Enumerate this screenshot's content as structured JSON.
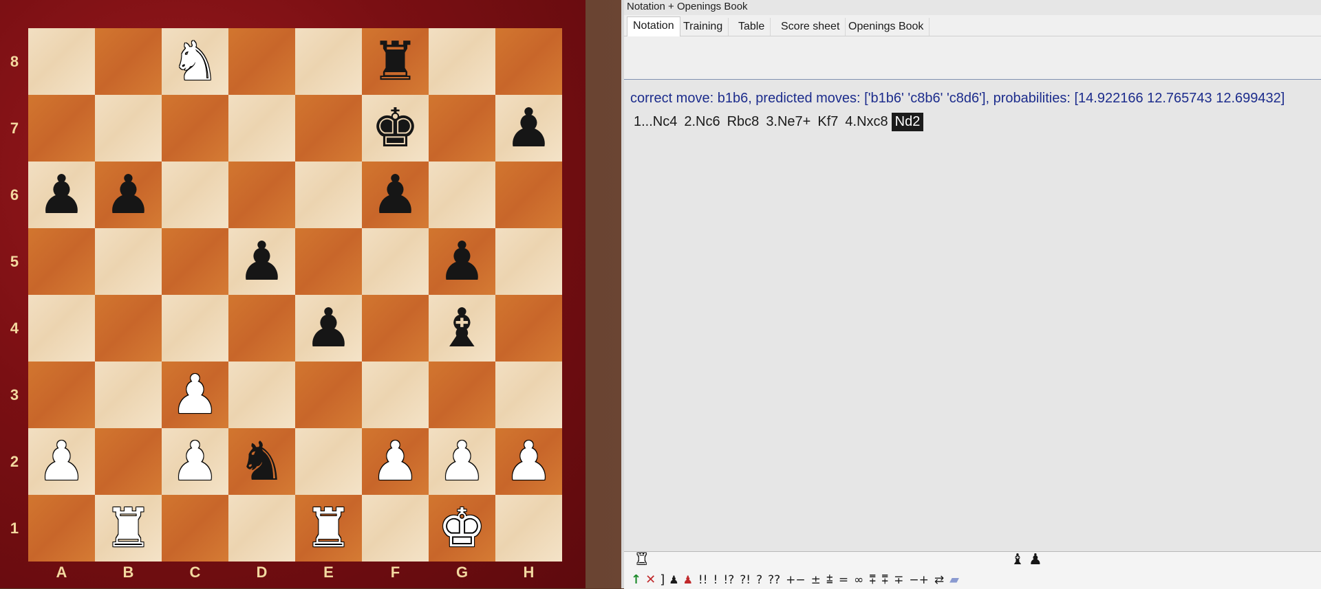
{
  "window": {
    "title": "Notation + Openings Book"
  },
  "tabs": [
    "Notation",
    "Training",
    "Table",
    "Score sheet",
    "Openings Book"
  ],
  "active_tab": "Notation",
  "prediction_text": "correct move: b1b6, predicted moves: ['b1b6' 'c8b6' 'c8d6'], probabilities: [14.922166 12.765743 12.699432]",
  "moves": [
    "1...Nc4",
    "2.Nc6",
    "Rbc8",
    "3.Ne7+",
    "Kf7",
    "4.Nxc8",
    "Nd2"
  ],
  "current_move": "Nd2",
  "board": {
    "files": [
      "A",
      "B",
      "C",
      "D",
      "E",
      "F",
      "G",
      "H"
    ],
    "ranks": [
      "8",
      "7",
      "6",
      "5",
      "4",
      "3",
      "2",
      "1"
    ],
    "pieces": {
      "c8": "♞w",
      "f8": "♜b",
      "f7": "♚b",
      "h7": "♟b",
      "a6": "♟b",
      "b6": "♟b",
      "f6": "♟b",
      "d5": "♟b",
      "g5": "♟b",
      "e4": "♟b",
      "g4": "♝b",
      "c3": "♟w",
      "a2": "♟w",
      "c2": "♟w",
      "d2": "♞b",
      "f2": "♟w",
      "g2": "♟w",
      "h2": "♟w",
      "b1": "♜w",
      "e1": "♜w",
      "g1": "♚w"
    }
  },
  "toolbar": {
    "row1_icons": [
      "rook-icon",
      "bishop-icon",
      "pawn-icon"
    ],
    "row2_icons": [
      "green-arrow-icon",
      "delete-variation-icon",
      "bracket-icon",
      "black-piece-icon",
      "red-piece-icon"
    ],
    "symbols": [
      "!!",
      "!",
      "!?",
      "?!",
      "?",
      "??",
      "+−",
      "±",
      "⩲",
      "=",
      "∞",
      "⩱",
      "⩱",
      "∓",
      "−+",
      "⇄"
    ],
    "eraser": "eraser-icon"
  }
}
